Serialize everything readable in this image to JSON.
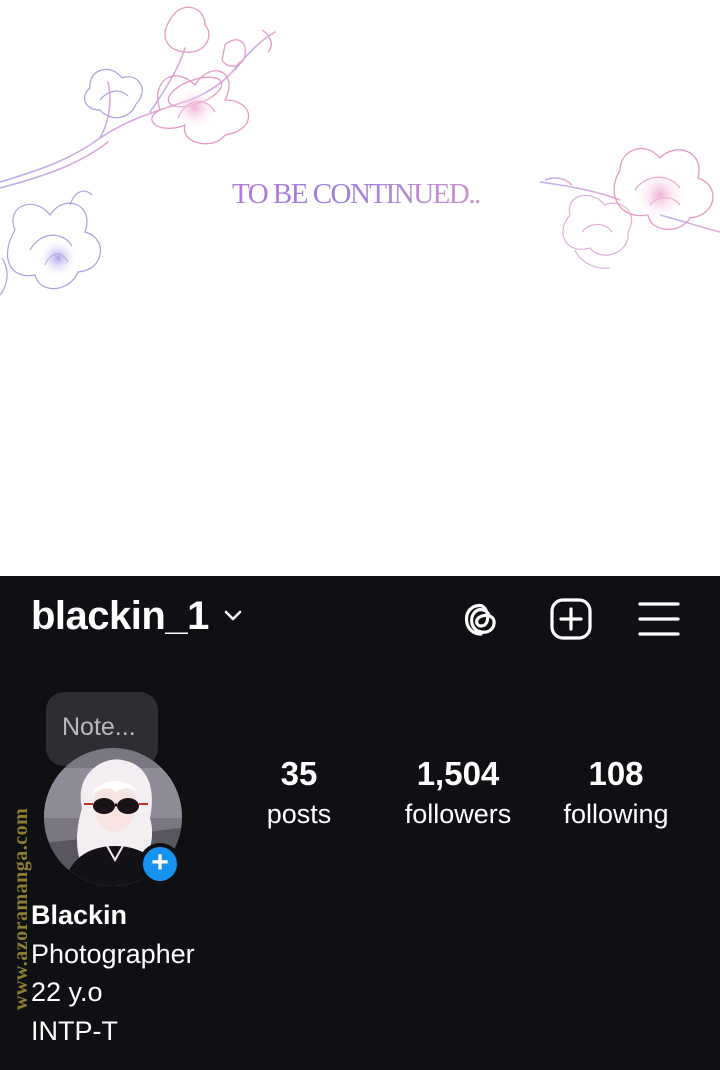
{
  "panel": {
    "caption": "TO BE CONTINUED.."
  },
  "profile": {
    "username": "blackin_1",
    "top_icons": [
      "chevron-down-icon",
      "threads-icon",
      "new-post-icon",
      "menu-icon"
    ],
    "note_placeholder": "Note...",
    "stats": {
      "posts": {
        "value": "35",
        "label": "posts"
      },
      "followers": {
        "value": "1,504",
        "label": "followers"
      },
      "following": {
        "value": "108",
        "label": "following"
      }
    },
    "bio": {
      "name": "Blackin",
      "lines": [
        "Photographer",
        "22 y.o",
        "INTP-T"
      ]
    },
    "add_story_symbol": "+"
  },
  "watermark": "www.azoramanga.com",
  "colors": {
    "background_dark": "#0f1014",
    "accent_blue": "#1591ee",
    "caption_purple": "#a777d3",
    "flower_pink": "#e79ac8",
    "flower_violet": "#a9a2e2"
  }
}
